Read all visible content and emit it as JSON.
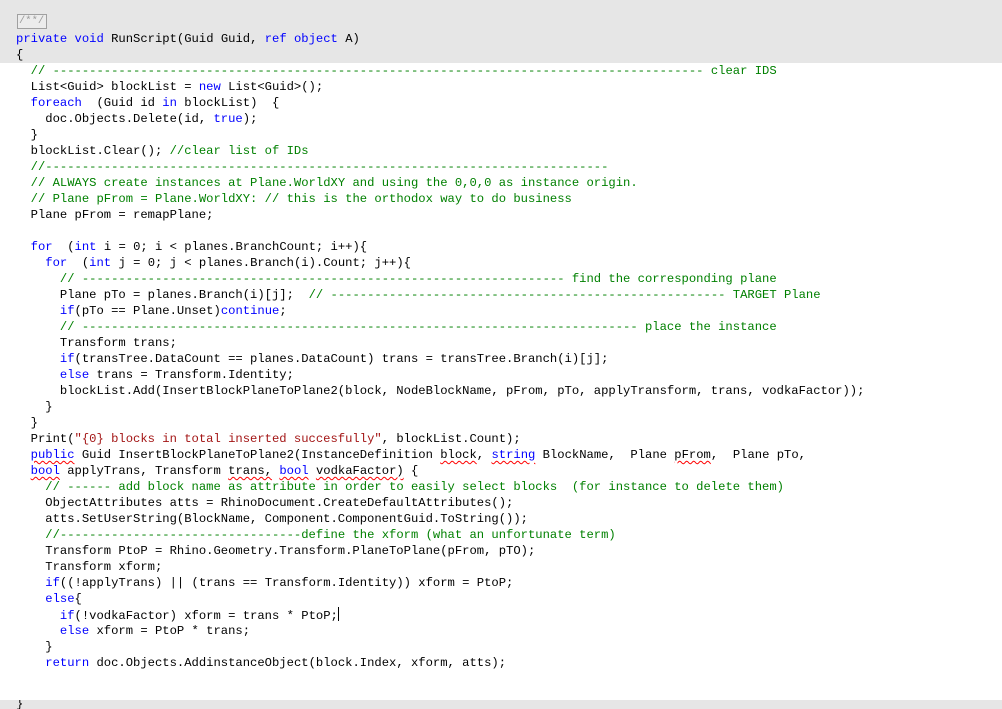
{
  "header": {
    "fold_marker": "/**/",
    "signature": "private void RunScript(Guid Guid, ref object A)",
    "open_brace": "{"
  },
  "footer": {
    "closing_brace": "}"
  },
  "lines": [
    [
      [
        "c",
        "  "
      ],
      [
        "cm",
        "// ----------------------------------------------------------------------------------------- clear IDS"
      ]
    ],
    [
      [
        "c",
        "  List<Guid> blockList = "
      ],
      [
        "kw",
        "new"
      ],
      [
        "c",
        " List<Guid>();"
      ]
    ],
    [
      [
        "c",
        "  "
      ],
      [
        "kw",
        "foreach"
      ],
      [
        "c",
        "  (Guid id "
      ],
      [
        "kw",
        "in"
      ],
      [
        "c",
        " blockList)  {"
      ]
    ],
    [
      [
        "c",
        "    doc.Objects.Delete(id, "
      ],
      [
        "kw",
        "true"
      ],
      [
        "c",
        ");"
      ]
    ],
    [
      [
        "c",
        "  }"
      ]
    ],
    [
      [
        "c",
        "  blockList.Clear(); "
      ],
      [
        "cm",
        "//clear list of IDs"
      ]
    ],
    [
      [
        "c",
        "  "
      ],
      [
        "cm",
        "//-----------------------------------------------------------------------------"
      ]
    ],
    [
      [
        "c",
        "  "
      ],
      [
        "cm",
        "// ALWAYS create instances at Plane.WorldXY and using the 0,0,0 as instance origin."
      ]
    ],
    [
      [
        "c",
        "  "
      ],
      [
        "cm",
        "// Plane pFrom = Plane.WorldXY: // this is the orthodox way to do business"
      ]
    ],
    [
      [
        "c",
        "  Plane pFrom = remapPlane;"
      ]
    ],
    [
      [
        "c",
        ""
      ]
    ],
    [
      [
        "c",
        "  "
      ],
      [
        "kw",
        "for"
      ],
      [
        "c",
        "  ("
      ],
      [
        "kw",
        "int"
      ],
      [
        "c",
        " i = 0; i < planes.BranchCount; i++){"
      ]
    ],
    [
      [
        "c",
        "    "
      ],
      [
        "kw",
        "for"
      ],
      [
        "c",
        "  ("
      ],
      [
        "kw",
        "int"
      ],
      [
        "c",
        " j = 0; j < planes.Branch(i).Count; j++){"
      ]
    ],
    [
      [
        "c",
        "      "
      ],
      [
        "cm",
        "// ------------------------------------------------------------------ find the corresponding plane"
      ]
    ],
    [
      [
        "c",
        "      Plane pTo = planes.Branch(i)[j];  "
      ],
      [
        "cm",
        "// ------------------------------------------------------ TARGET Plane"
      ]
    ],
    [
      [
        "c",
        "      "
      ],
      [
        "kw",
        "if"
      ],
      [
        "c",
        "(pTo == Plane.Unset)"
      ],
      [
        "kw",
        "continue"
      ],
      [
        "c",
        ";"
      ]
    ],
    [
      [
        "c",
        "      "
      ],
      [
        "cm",
        "// ---------------------------------------------------------------------------- place the instance"
      ]
    ],
    [
      [
        "c",
        "      Transform trans;"
      ]
    ],
    [
      [
        "c",
        "      "
      ],
      [
        "kw",
        "if"
      ],
      [
        "c",
        "(transTree.DataCount == planes.DataCount) trans = transTree.Branch(i)[j];"
      ]
    ],
    [
      [
        "c",
        "      "
      ],
      [
        "kw",
        "else"
      ],
      [
        "c",
        " trans = Transform.Identity;"
      ]
    ],
    [
      [
        "c",
        "      blockList.Add(InsertBlockPlaneToPlane2(block, NodeBlockName, pFrom, pTo, applyTransform, trans, vodkaFactor));"
      ]
    ],
    [
      [
        "c",
        "    }"
      ]
    ],
    [
      [
        "c",
        "  }"
      ]
    ],
    [
      [
        "c",
        "  Print("
      ],
      [
        "st",
        "\"{0} blocks in total inserted succesfully\""
      ],
      [
        "c",
        ", blockList.Count);"
      ]
    ],
    [
      [
        "c",
        "  "
      ],
      [
        "kw",
        "public"
      ],
      [
        "c",
        " Guid InsertBlockPlaneToPlane2(InstanceDefinition block, "
      ],
      [
        "kw",
        "string"
      ],
      [
        "c",
        " BlockName,  Plane pFrom,  Plane pTo,"
      ]
    ],
    [
      [
        "c",
        "  "
      ],
      [
        "kw",
        "bool"
      ],
      [
        "c",
        " applyTrans, Transform trans, "
      ],
      [
        "kw",
        "bool"
      ],
      [
        "c",
        " vodkaFactor) {"
      ]
    ],
    [
      [
        "c",
        "    "
      ],
      [
        "cm",
        "// ------ add block name as attribute in order to easily select blocks  (for instance to delete them)"
      ]
    ],
    [
      [
        "c",
        "    ObjectAttributes atts = RhinoDocument.CreateDefaultAttributes();"
      ]
    ],
    [
      [
        "c",
        "    atts.SetUserString(BlockName, Component.ComponentGuid.ToString());"
      ]
    ],
    [
      [
        "c",
        "    "
      ],
      [
        "cm",
        "//---------------------------------define the xform (what an unfortunate term)"
      ]
    ],
    [
      [
        "c",
        "    Transform PtoP = Rhino.Geometry.Transform.PlaneToPlane(pFrom, pTO);"
      ]
    ],
    [
      [
        "c",
        "    Transform xform;"
      ]
    ],
    [
      [
        "c",
        "    "
      ],
      [
        "kw",
        "if"
      ],
      [
        "c",
        "((!applyTrans) || (trans == Transform.Identity)) xform = PtoP;"
      ]
    ],
    [
      [
        "c",
        "    "
      ],
      [
        "kw",
        "else"
      ],
      [
        "c",
        "{"
      ]
    ],
    [
      [
        "c",
        "      "
      ],
      [
        "kw",
        "if"
      ],
      [
        "c",
        "(!vodkaFactor) xform = trans * PtoP;"
      ]
    ],
    [
      [
        "c",
        "      "
      ],
      [
        "kw",
        "else"
      ],
      [
        "c",
        " xform = PtoP * trans;"
      ]
    ],
    [
      [
        "c",
        "    }"
      ]
    ],
    [
      [
        "c",
        "    "
      ],
      [
        "kw",
        "return"
      ],
      [
        "c",
        " doc.Objects.AddinstanceObject(block.Index, xform, atts);"
      ]
    ]
  ]
}
